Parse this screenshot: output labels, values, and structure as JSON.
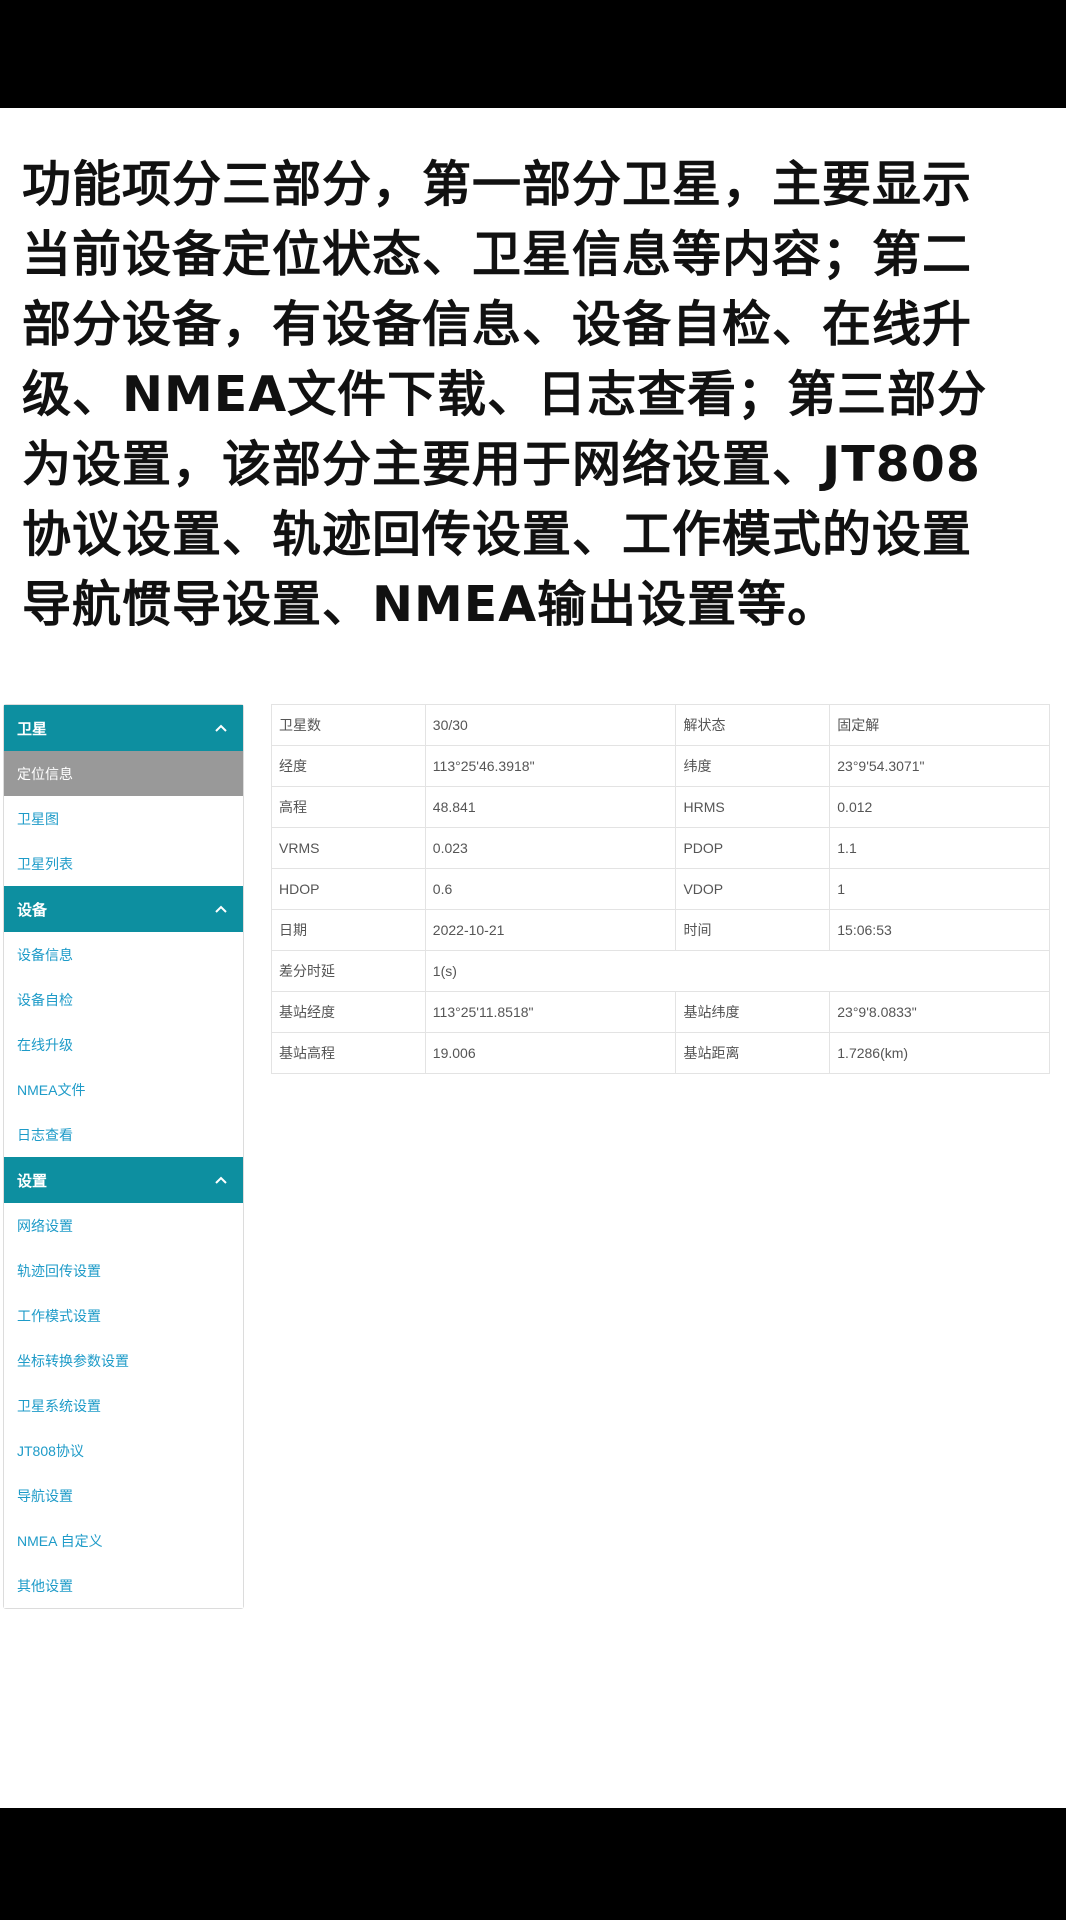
{
  "caption": {
    "lines": [
      "功能项分三部分，第一部分卫星，主要显示",
      "当前设备定位状态、卫星信息等内容；第二",
      "部分设备，有设备信息、设备自检、在线升",
      "级、NMEA文件下载、日志查看；第三部分",
      "为设置，该部分主要用于网络设置、JT808",
      "协议设置、轨迹回传设置、工作模式的设置",
      "导航惯导设置、NMEA输出设置等。"
    ]
  },
  "sidebar": {
    "sections": [
      {
        "title": "卫星",
        "icon": "chevron-up-icon",
        "items": [
          {
            "label": "定位信息",
            "active": true
          },
          {
            "label": "卫星图"
          },
          {
            "label": "卫星列表"
          }
        ]
      },
      {
        "title": "设备",
        "icon": "chevron-up-icon",
        "items": [
          {
            "label": "设备信息"
          },
          {
            "label": "设备自检"
          },
          {
            "label": "在线升级"
          },
          {
            "label": "NMEA文件"
          },
          {
            "label": "日志查看"
          }
        ]
      },
      {
        "title": "设置",
        "icon": "chevron-up-icon",
        "items": [
          {
            "label": "网络设置"
          },
          {
            "label": "轨迹回传设置"
          },
          {
            "label": "工作模式设置"
          },
          {
            "label": "坐标转换参数设置"
          },
          {
            "label": "卫星系统设置"
          },
          {
            "label": "JT808协议"
          },
          {
            "label": "导航设置"
          },
          {
            "label": "NMEA 自定义"
          },
          {
            "label": "其他设置"
          }
        ]
      }
    ]
  },
  "info": {
    "rows": [
      [
        "卫星数",
        "30/30",
        "解状态",
        "固定解"
      ],
      [
        "经度",
        "113°25'46.3918\"",
        "纬度",
        "23°9'54.3071\""
      ],
      [
        "高程",
        "48.841",
        "HRMS",
        "0.012"
      ],
      [
        "VRMS",
        "0.023",
        "PDOP",
        "1.1"
      ],
      [
        "HDOP",
        "0.6",
        "VDOP",
        "1"
      ],
      [
        "日期",
        "2022-10-21",
        "时间",
        "15:06:53"
      ],
      [
        "差分时延",
        "1(s)"
      ],
      [
        "基站经度",
        "113°25'11.8518\"",
        "基站纬度",
        "23°9'8.0833\""
      ],
      [
        "基站高程",
        "19.006",
        "基站距离",
        "1.7286(km)"
      ]
    ]
  },
  "colors": {
    "accent": "#0d8fa0",
    "link": "#1e9bc8",
    "active_bg": "#999999"
  }
}
